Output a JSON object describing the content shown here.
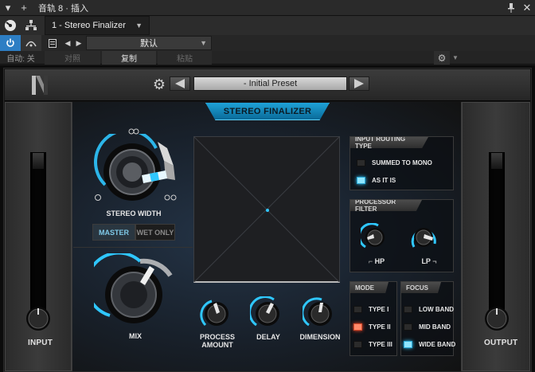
{
  "host": {
    "window_title": "音轨 8 · 插入",
    "plugin_name": "1 - Stereo Finalizer",
    "preset": "默认",
    "auto_label": "自动: 关",
    "compare_label": "对照",
    "copy_label": "复制",
    "paste_label": "粘贴"
  },
  "plugin": {
    "preset_name": "- Initial Preset",
    "title": "STEREO FINALIZER",
    "input_label": "INPUT",
    "output_label": "OUTPUT",
    "stereo_width_label": "STEREO WIDTH",
    "master_label": "MASTER",
    "wet_only_label": "WET ONLY",
    "mix_label": "MIX",
    "process_amount_label": "PROCESS AMOUNT",
    "delay_label": "DELAY",
    "dimension_label": "DIMENSION",
    "routing": {
      "title": "INPUT ROUTING TYPE",
      "options": [
        "SUMMED TO MONO",
        "AS IT IS"
      ],
      "selected": "AS IT IS"
    },
    "filter": {
      "title": "PROCESSOR FILTER",
      "hp_label": "HP",
      "lp_label": "LP"
    },
    "mode": {
      "title": "MODE",
      "options": [
        "TYPE I",
        "TYPE II",
        "TYPE III"
      ],
      "selected": "TYPE II"
    },
    "focus": {
      "title": "FOCUS",
      "options": [
        "LOW BAND",
        "MID BAND",
        "WIDE BAND"
      ],
      "selected": "WIDE BAND"
    }
  },
  "colors": {
    "accent_blue": "#2fc7ff",
    "accent_red": "#ff4a2a",
    "host_blue": "#2d7ec4"
  },
  "icons": [
    "close-icon",
    "add-icon",
    "pin-icon",
    "chevron-down-icon",
    "gear-icon",
    "routing-icon",
    "power-icon",
    "bypass-icon",
    "list-icon",
    "arrow-left-icon",
    "arrow-right-icon",
    "logo-n-icon"
  ]
}
